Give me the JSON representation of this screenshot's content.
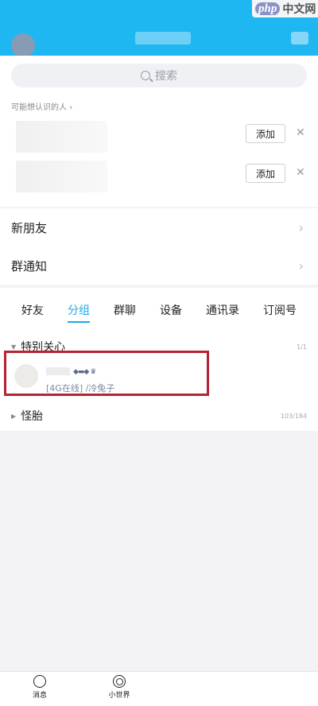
{
  "header": {
    "watermark_php": "php",
    "watermark_cn": "中文网"
  },
  "search": {
    "placeholder": "搜索"
  },
  "recommend": {
    "section_label": "可能想认识的人",
    "add_label": "添加",
    "close_glyph": "✕"
  },
  "nav": [
    {
      "label": "新朋友",
      "chevron": "›"
    },
    {
      "label": "群通知",
      "chevron": "›"
    }
  ],
  "tabs": [
    "好友",
    "分组",
    "群聊",
    "设备",
    "通讯录",
    "订阅号"
  ],
  "active_tab": "分组",
  "groups": [
    {
      "name": "特别关心",
      "count": "1/1",
      "expanded": true
    },
    {
      "name": "怪胎",
      "count": "103/184",
      "expanded": false
    }
  ],
  "friend": {
    "status": "[4G在线] /冷兔子"
  },
  "bottom_nav": [
    {
      "label": "消息",
      "icon": "message-bubble-icon"
    },
    {
      "label": "小世界",
      "icon": "small-world-icon"
    }
  ],
  "colors": {
    "accent": "#1fb7f2",
    "highlight": "#b62334"
  }
}
